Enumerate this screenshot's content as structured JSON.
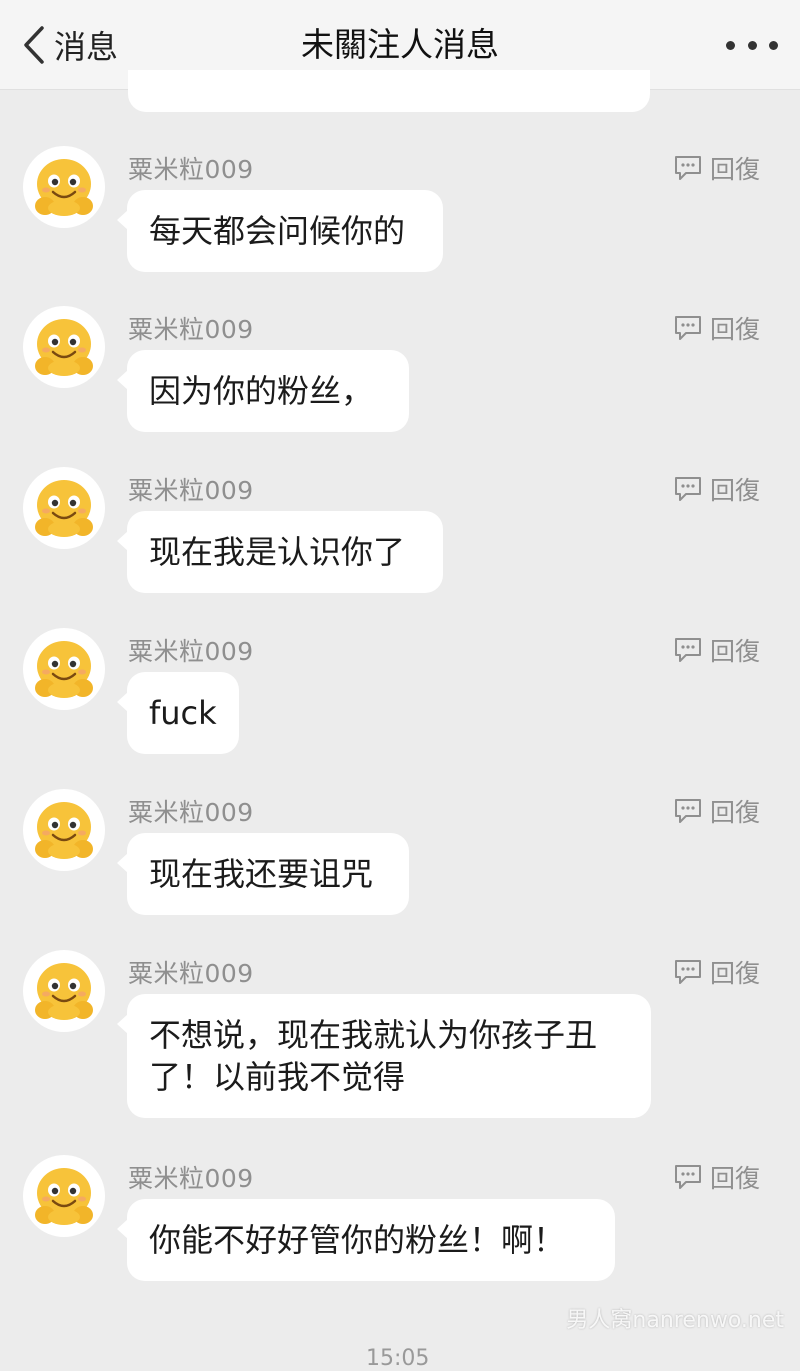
{
  "nav": {
    "back_label": "消息",
    "title": "未關注人消息",
    "more_icon": "ellipsis-icon"
  },
  "messages": [
    {
      "sender": "粟米粒009",
      "reply_label": "回復",
      "text": "每天都会问候你的"
    },
    {
      "sender": "粟米粒009",
      "reply_label": "回復",
      "text": "因为你的粉丝，"
    },
    {
      "sender": "粟米粒009",
      "reply_label": "回復",
      "text": "现在我是认识你了"
    },
    {
      "sender": "粟米粒009",
      "reply_label": "回復",
      "text": "fuck"
    },
    {
      "sender": "粟米粒009",
      "reply_label": "回復",
      "text": "现在我还要诅咒"
    },
    {
      "sender": "粟米粒009",
      "reply_label": "回復",
      "text": "不想说，现在我就认为你孩子丑了！以前我不觉得"
    },
    {
      "sender": "粟米粒009",
      "reply_label": "回復",
      "text": "你能不好好管你的粉丝！啊！"
    }
  ],
  "footer": {
    "time": "15:05",
    "watermark": "男人窝nanrenwo.net"
  },
  "colors": {
    "background": "#ececec",
    "bubble": "#ffffff",
    "meta_text": "#8f8f8f",
    "avatar_face": "#f7c33a"
  }
}
